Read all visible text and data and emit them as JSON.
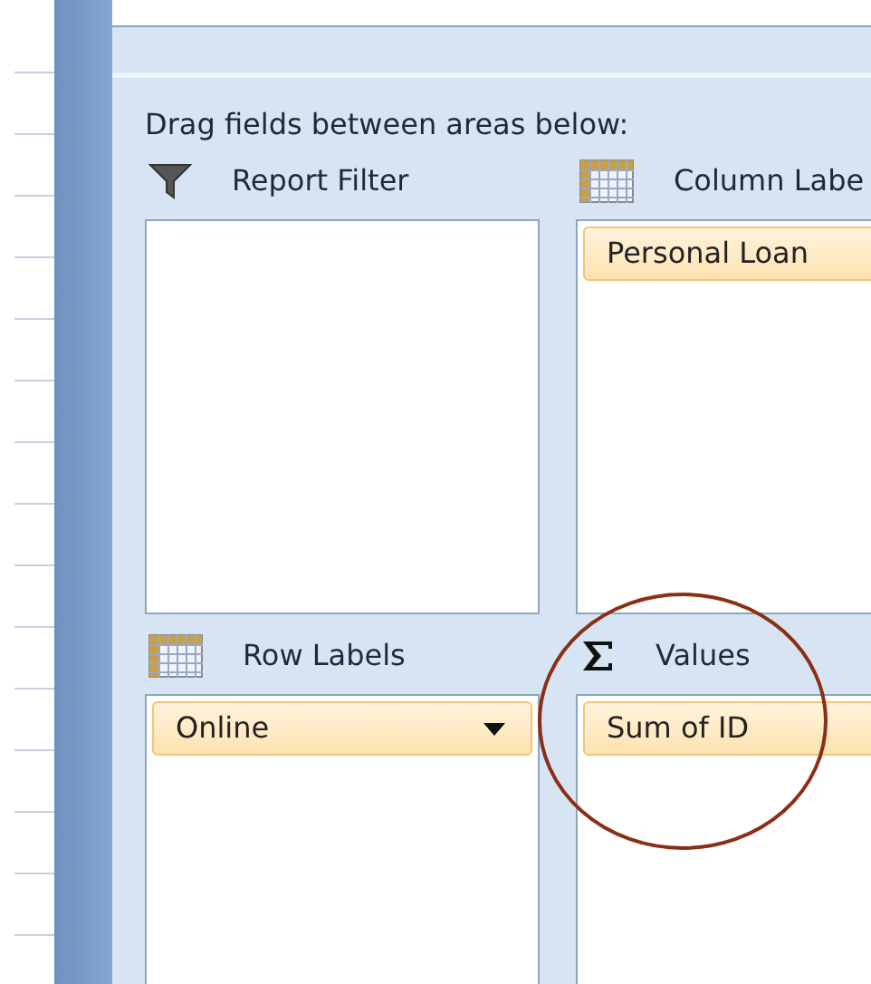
{
  "instruction": "Drag fields between areas below:",
  "areas": [
    {
      "kind": "filter",
      "title": "Report Filter"
    },
    {
      "kind": "grid",
      "title": "Column Labe",
      "fields": [
        {
          "label": "Personal Loan"
        }
      ]
    },
    {
      "kind": "grid",
      "title": "Row Labels",
      "fields": [
        {
          "label": "Online",
          "dropdown": true
        }
      ]
    },
    {
      "kind": "sigma",
      "title": "Values",
      "fields": [
        {
          "label": "Sum of ID"
        }
      ]
    }
  ]
}
